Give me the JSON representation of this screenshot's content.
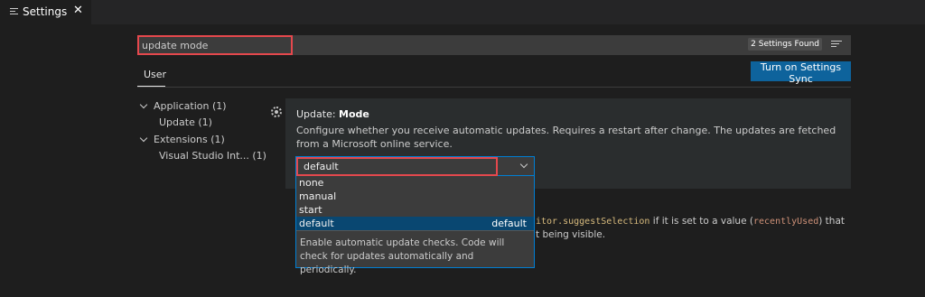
{
  "tab": {
    "label": "Settings",
    "close": "✕"
  },
  "search": {
    "value": "update mode",
    "found": "2 Settings Found"
  },
  "scope_tab": {
    "label": "User"
  },
  "sync_button": {
    "label": "Turn on Settings Sync"
  },
  "toc": {
    "items": [
      {
        "label": "Application (1)",
        "expanded": true
      },
      {
        "label": "Update (1)"
      },
      {
        "label": "Extensions (1)",
        "expanded": true
      },
      {
        "label": "Visual Studio Int... (1)"
      }
    ]
  },
  "setting": {
    "title_prefix": "Update: ",
    "title_name": "Mode",
    "description": "Configure whether you receive automatic updates. Requires a restart after change. The updates are fetched from a Microsoft online service.",
    "value": "default"
  },
  "dropdown": {
    "options": [
      "none",
      "manual",
      "start",
      "default"
    ],
    "selected_index": 3,
    "selected_hint": "default",
    "description": "Enable automatic update checks. Code will check for updates automatically and periodically."
  },
  "second_setting": {
    "line1_code": "itor.suggestSelection",
    "line1_text": " if it is set to a value (",
    "line1_code2": "recentlyUsed",
    "line1_end": ") that",
    "line2": "t being visible."
  },
  "colors": {
    "accent": "#0e639c",
    "highlight_border": "#e5484d",
    "focus_border": "#007fd4",
    "selected_option": "#094771"
  }
}
